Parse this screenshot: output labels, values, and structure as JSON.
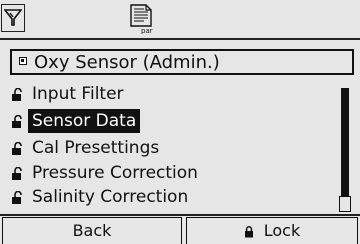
{
  "header": {
    "menu_icon": "menu-tab-icon",
    "doc_icon": "parameter-document-icon",
    "doc_icon_caption": "par"
  },
  "title": "Oxy Sensor (Admin.)",
  "menu": {
    "items": [
      {
        "label": "Input Filter",
        "locked": true,
        "selected": false
      },
      {
        "label": "Sensor Data",
        "locked": true,
        "selected": true
      },
      {
        "label": "Cal Presettings",
        "locked": true,
        "selected": false
      },
      {
        "label": "Pressure Correction",
        "locked": true,
        "selected": false
      },
      {
        "label": "Salinity Correction",
        "locked": true,
        "selected": false
      }
    ]
  },
  "softkeys": {
    "left": "Back",
    "right": "Lock"
  },
  "colors": {
    "background": "#e6e6e6",
    "foreground": "#111111",
    "highlight": "#111111",
    "highlight_text": "#ffffff"
  }
}
